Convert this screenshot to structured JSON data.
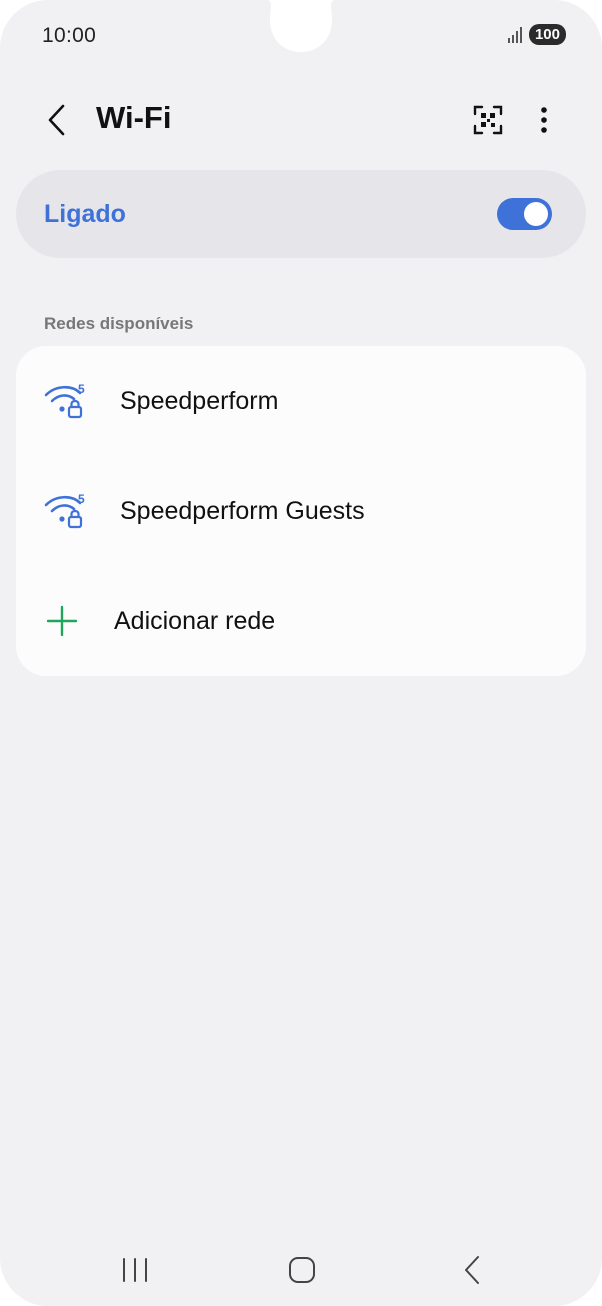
{
  "status_bar": {
    "time": "10:00",
    "battery": "100",
    "icons": [
      "signal-icon"
    ]
  },
  "header": {
    "title": "Wi-Fi",
    "icons": [
      "back-arrow-icon",
      "qr-code-icon",
      "more-options-icon"
    ]
  },
  "wifi_toggle": {
    "label": "Ligado",
    "state": "on"
  },
  "available_networks": {
    "header": "Redes disponíveis",
    "items": [
      {
        "label": "Speedperform",
        "icon": "wifi-5ghz-locked-icon"
      },
      {
        "label": "Speedperform Guests",
        "icon": "wifi-5ghz-locked-icon"
      }
    ],
    "add_network": {
      "label": "Adicionar rede",
      "icon": "plus-icon"
    }
  },
  "colors": {
    "accent": "#3e72d8",
    "background": "#f1f1f3",
    "card": "#fcfcfd",
    "add_green": "#1fa65a"
  },
  "nav_bar": {
    "icons": [
      "recents-icon",
      "home-icon",
      "back-icon"
    ]
  }
}
